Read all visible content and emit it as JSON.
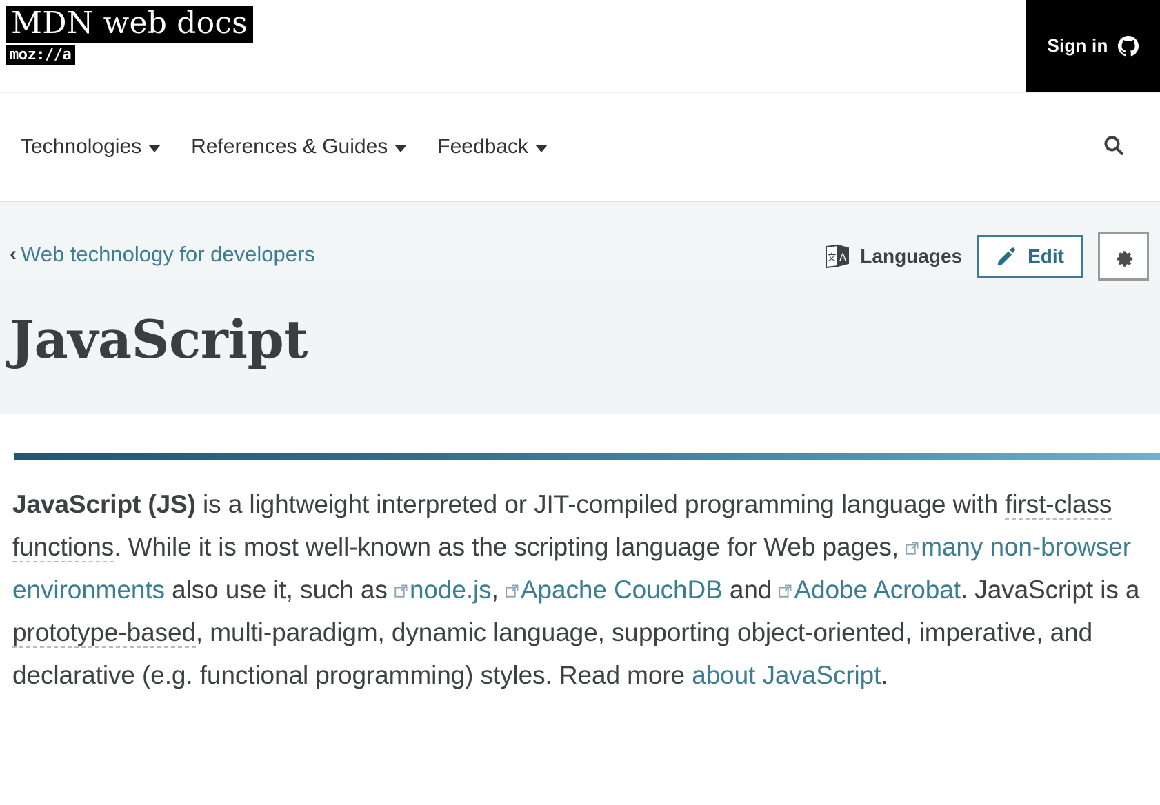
{
  "header": {
    "logo_main": "MDN web docs",
    "logo_sub": "moz://a",
    "signin_label": "Sign in",
    "signin_icon": "github-octocat-icon"
  },
  "nav": {
    "items": [
      {
        "label": "Technologies",
        "icon": "chevron-down-icon"
      },
      {
        "label": "References & Guides",
        "icon": "chevron-down-icon"
      },
      {
        "label": "Feedback",
        "icon": "chevron-down-icon"
      }
    ],
    "search_icon": "search-icon"
  },
  "page": {
    "breadcrumb_chevron": "‹",
    "breadcrumb_label": "Web technology for developers",
    "title": "JavaScript",
    "languages_label": "Languages",
    "languages_icon": "translate-icon",
    "edit_label": "Edit",
    "edit_icon": "pencil-icon",
    "settings_icon": "gear-icon"
  },
  "article": {
    "intro": {
      "lead_bold": "JavaScript (JS)",
      "t1": " is a lightweight interpreted or JIT-compiled programming language with ",
      "glossary1": "first-class functions",
      "t2": ". While it is most well-known as the scripting language for Web pages, ",
      "link1": "many non-browser environments",
      "t3": " also use it, such as ",
      "link2": "node.js",
      "t4": ", ",
      "link3": "Apache CouchDB",
      "t5": " and ",
      "link4": "Adobe Acrobat",
      "t6": ". JavaScript is a ",
      "glossary2": "prototype-based",
      "t7": ", multi-paradigm, dynamic language, supporting object-oriented, imperative, and declarative (e.g. functional programming) styles. Read more ",
      "link5": "about JavaScript",
      "t8": "."
    }
  },
  "colors": {
    "link": "#3b7d93",
    "accent_rule_start": "#1b5a70",
    "accent_rule_end": "#6bb4d0",
    "text": "#3d4144",
    "black": "#000000"
  }
}
